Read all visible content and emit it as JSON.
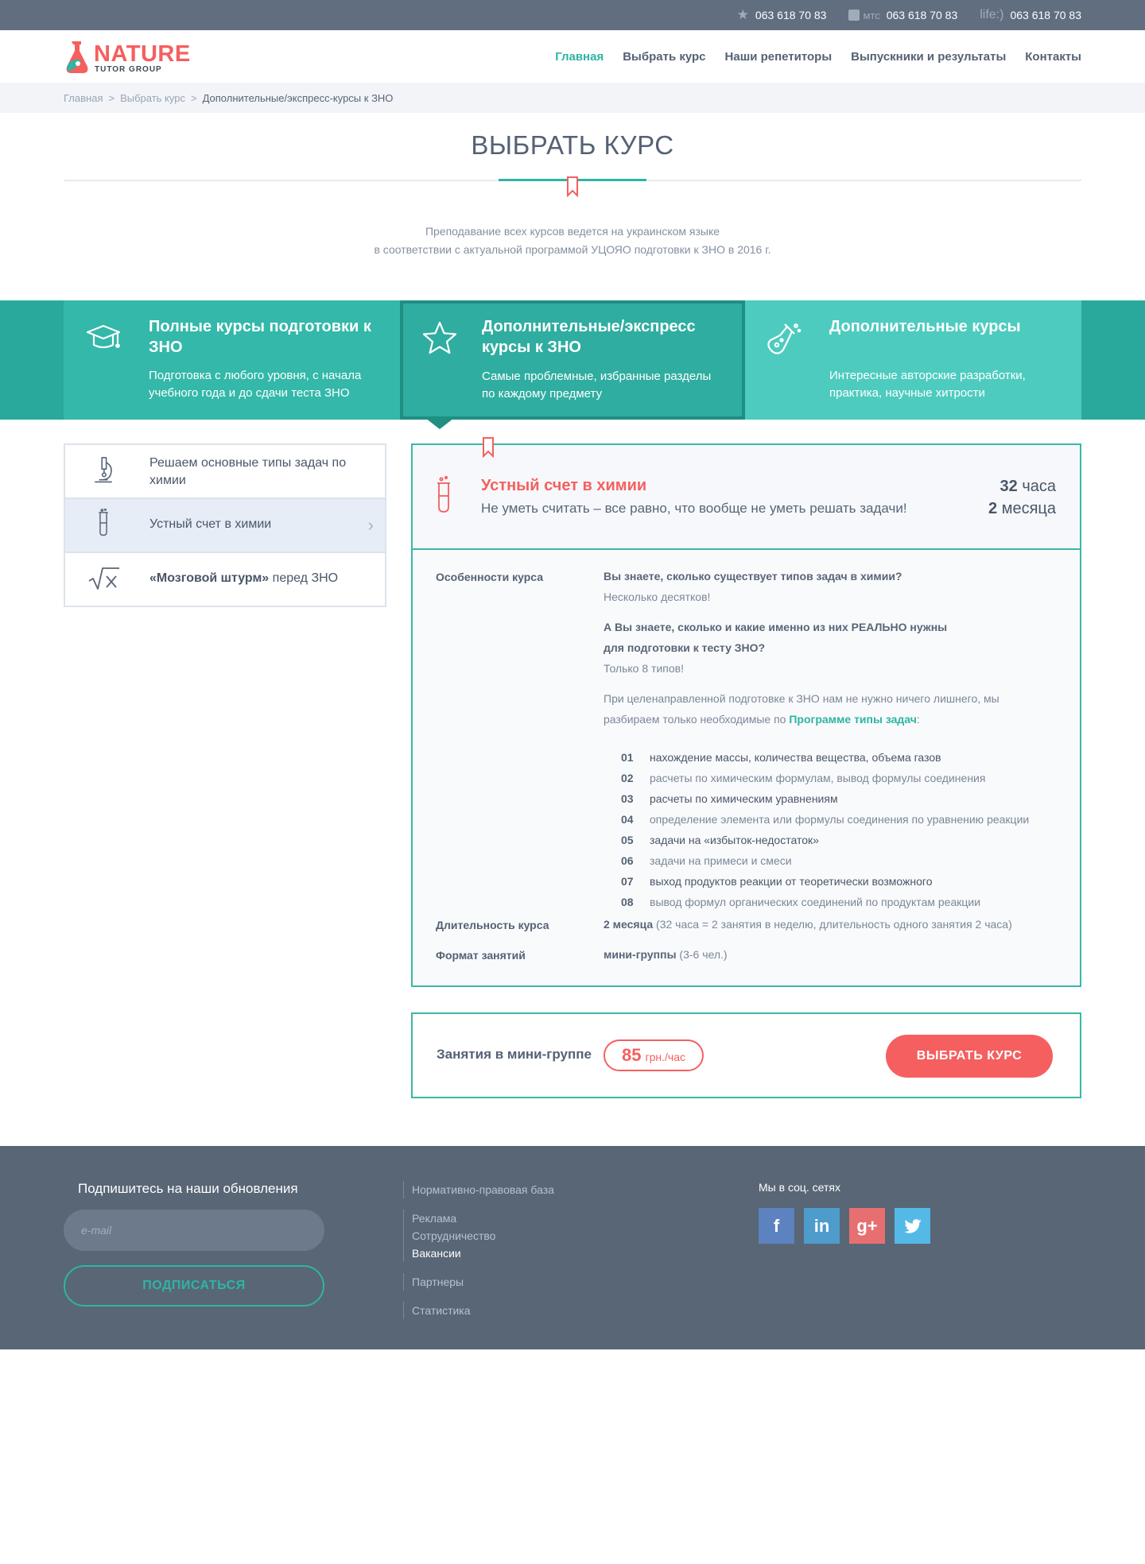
{
  "topbar": {
    "phones": [
      {
        "operator": "",
        "operator_icon": "star-icon",
        "number": "063 618 70 83"
      },
      {
        "operator": "мтс",
        "operator_icon": "mts-icon",
        "number": "063 618 70 83"
      },
      {
        "operator": "life:)",
        "operator_icon": "life-icon",
        "number": "063 618 70 83"
      }
    ]
  },
  "header": {
    "logo": {
      "name": "NATURE",
      "sub": "TUTOR GROUP"
    },
    "nav": [
      {
        "label": "Главная",
        "active": true
      },
      {
        "label": "Выбрать курс"
      },
      {
        "label": "Наши репетиторы"
      },
      {
        "label": "Выпускники и результаты"
      },
      {
        "label": "Контакты"
      }
    ]
  },
  "breadcrumb": {
    "items": [
      "Главная",
      "Выбрать курс",
      "Дополнительные/экспресс-курсы к ЗНО"
    ],
    "separator": ">"
  },
  "page": {
    "title": "ВЫБРАТЬ КУРС",
    "intro_line1": "Преподавание всех курсов ведется на украинском языке",
    "intro_line2": "в соответствии с актуальной программой УЦОЯО подготовки к ЗНО в 2016 г."
  },
  "tabs": [
    {
      "title": "Полные курсы подготовки к ЗНО",
      "desc": "Подготовка с любого уровня, с начала учебного года и до сдачи теста ЗНО",
      "icon": "graduation-cap-icon"
    },
    {
      "title": "Дополнительные/экспресс курсы к ЗНО",
      "desc": "Самые проблемные, избранные разделы по каждому предмету",
      "icon": "star-icon",
      "active": true
    },
    {
      "title": "Дополнительные курсы",
      "desc": "Интересные авторские разработки, практика, научные хитрости",
      "icon": "flask-icon"
    }
  ],
  "side": {
    "items": [
      {
        "label": "Решаем основные типы задач по химии",
        "icon": "microscope-icon"
      },
      {
        "label": "Устный счет в химии",
        "icon": "test-tube-icon",
        "active": true
      },
      {
        "label_bold": "«Мозговой штурм»",
        "label_rest": " перед ЗНО",
        "icon": "square-root-icon"
      }
    ]
  },
  "course": {
    "title": "Устный счет в химии",
    "subtitle": "Не уметь считать – все равно, что вообще не уметь решать задачи!",
    "hours_num": "32",
    "hours_unit": "часа",
    "months_num": "2",
    "months_unit": "месяца",
    "features_label": "Особенности курса",
    "q1": "Вы знаете, сколько существует типов задач в химии?",
    "a1": "Несколько десятков!",
    "q2_line1": "А Вы знаете, сколько и какие именно из них РЕАЛЬНО нужны",
    "q2_line2": "для подготовки к тесту ЗНО?",
    "a2": "Только 8 типов!",
    "p1_line1": "При целенаправленной подготовке к ЗНО нам не нужно ничего лишнего, мы",
    "p1_line2_start": "разбираем только необходимые по ",
    "p1_link": "Программе типы задач",
    "p1_end": ":",
    "tasks": [
      {
        "num": "01",
        "text": "нахождение массы, количества вещества, объема газов"
      },
      {
        "num": "02",
        "text": "расчеты по химическим формулам, вывод формулы соединения"
      },
      {
        "num": "03",
        "text": "расчеты по химическим уравнениям"
      },
      {
        "num": "04",
        "text": "определение элемента или формулы соединения по уравнению реакции"
      },
      {
        "num": "05",
        "text": "задачи на «избыток-недостаток»"
      },
      {
        "num": "06",
        "text": "задачи на примеси и смеси"
      },
      {
        "num": "07",
        "text": "выход продуктов реакции от теоретически возможного"
      },
      {
        "num": "08",
        "text": "вывод формул органических соединений по продуктам реакции"
      }
    ],
    "duration_label": "Длительность курса",
    "duration_value": "2 месяца",
    "duration_note": " (32 часа = 2 занятия в неделю, длительность одного занятия 2 часа)",
    "format_label": "Формат занятий",
    "format_value": "мини-группы",
    "format_note": " (3-6 чел.)"
  },
  "price": {
    "label": "Занятия в мини-группе",
    "value": "85",
    "unit": "грн./час",
    "button": "ВЫБРАТЬ КУРС"
  },
  "footer": {
    "subscribe_title": "Подпишитесь на наши обновления",
    "email_placeholder": "e-mail",
    "subscribe_button": "ПОДПИСАТЬСЯ",
    "link_groups": [
      [
        "Нормативно-правовая база"
      ],
      [
        "Реклама",
        "Сотрудничество",
        "Вакансии"
      ],
      [
        "Партнеры"
      ],
      [
        "Статистика"
      ]
    ],
    "active_link": "Вакансии",
    "social_title": "Мы в соц. сетях",
    "socials": [
      "facebook-icon",
      "linkedin-icon",
      "google-plus-icon",
      "twitter-icon"
    ]
  },
  "colors": {
    "accent_teal": "#2eb5a3",
    "accent_red": "#f55f5f",
    "topbar": "#606e80",
    "footer": "#586676"
  }
}
